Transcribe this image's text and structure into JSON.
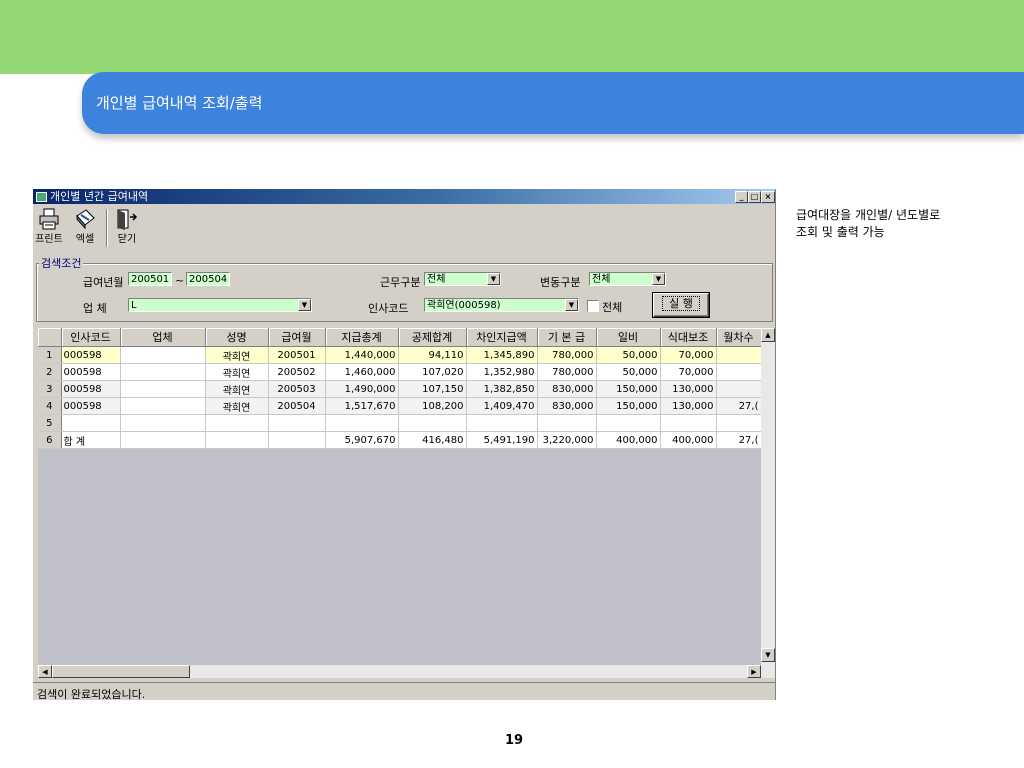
{
  "slide": {
    "title": "개인별 급여내역 조회/출력",
    "description_line1": "급여대장을 개인별/ 년도별로",
    "description_line2": "조회 및 출력 가능",
    "page_number": "19",
    "colors": {
      "header_green": "#93d873",
      "header_blue": "#3d82dd"
    }
  },
  "window": {
    "title": "개인별 년간 급여내역",
    "min_button": "_",
    "max_button": "□",
    "close_button": "×"
  },
  "toolbar": {
    "print_label": "프린트",
    "excel_label": "엑셀",
    "close_label": "닫기",
    "print_icon": "printer-icon",
    "excel_icon": "excel-export-icon",
    "close_icon": "exit-door-icon"
  },
  "search": {
    "group_label": "검색조건",
    "pay_month_label": "급여년월",
    "pay_month_from": "200501",
    "range_sep": "~",
    "pay_month_to": "200504",
    "company_label": "업     체",
    "company_value": "L",
    "work_type_label": "근무구분",
    "work_type_value": "전체",
    "change_type_label": "변동구분",
    "change_type_value": "전체",
    "emp_code_label": "인사코드",
    "emp_code_value": "곽희연(000598)",
    "all_checkbox_label": "전체",
    "run_button": "실  행"
  },
  "grid": {
    "columns": [
      "인사코드",
      "업체",
      "성명",
      "급여월",
      "지급총계",
      "공제합계",
      "차인지급액",
      "기 본 급",
      "일비",
      "식대보조",
      "월차수"
    ],
    "rows": [
      {
        "no": "1",
        "code": "000598",
        "company": "",
        "name": "곽희연",
        "month": "200501",
        "total_pay": "1,440,000",
        "deduction": "94,110",
        "net_pay": "1,345,890",
        "base": "780,000",
        "daily": "50,000",
        "meal": "70,000",
        "monthly": ""
      },
      {
        "no": "2",
        "code": "000598",
        "company": "",
        "name": "곽희연",
        "month": "200502",
        "total_pay": "1,460,000",
        "deduction": "107,020",
        "net_pay": "1,352,980",
        "base": "780,000",
        "daily": "50,000",
        "meal": "70,000",
        "monthly": ""
      },
      {
        "no": "3",
        "code": "000598",
        "company": "",
        "name": "곽희연",
        "month": "200503",
        "total_pay": "1,490,000",
        "deduction": "107,150",
        "net_pay": "1,382,850",
        "base": "830,000",
        "daily": "150,000",
        "meal": "130,000",
        "monthly": ""
      },
      {
        "no": "4",
        "code": "000598",
        "company": "",
        "name": "곽희연",
        "month": "200504",
        "total_pay": "1,517,670",
        "deduction": "108,200",
        "net_pay": "1,409,470",
        "base": "830,000",
        "daily": "150,000",
        "meal": "130,000",
        "monthly": "27,("
      },
      {
        "no": "5",
        "code": "",
        "company": "",
        "name": "",
        "month": "",
        "total_pay": "",
        "deduction": "",
        "net_pay": "",
        "base": "",
        "daily": "",
        "meal": "",
        "monthly": ""
      },
      {
        "no": "6",
        "code": "합 계",
        "company": "",
        "name": "",
        "month": "",
        "total_pay": "5,907,670",
        "deduction": "416,480",
        "net_pay": "5,491,190",
        "base": "3,220,000",
        "daily": "400,000",
        "meal": "400,000",
        "monthly": "27,("
      }
    ]
  },
  "status": {
    "text": "검색이 완료되었습니다."
  }
}
